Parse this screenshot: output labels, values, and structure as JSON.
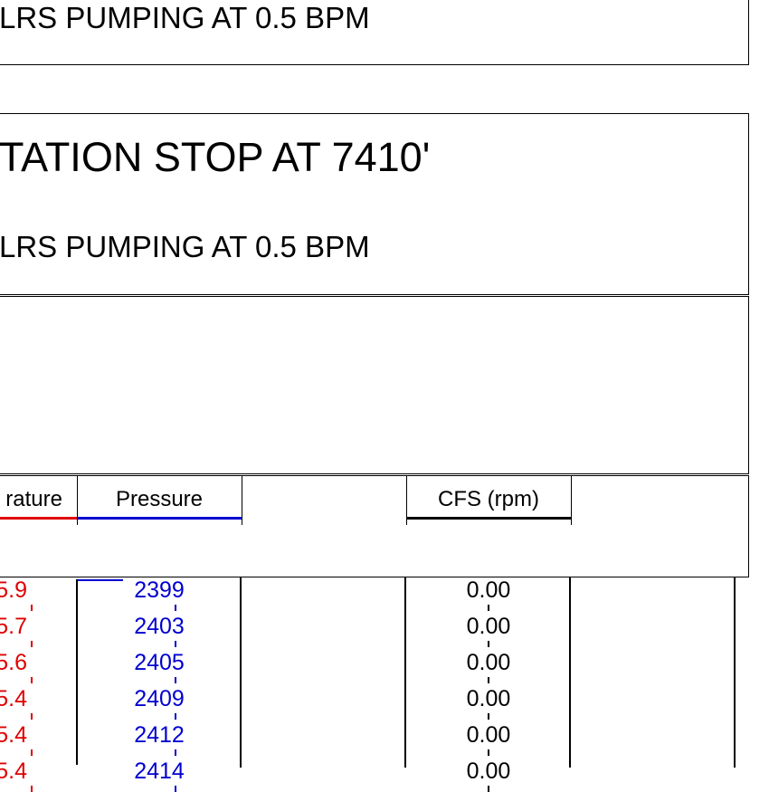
{
  "box1": {
    "text": "LRS PUMPING AT 0.5 BPM"
  },
  "box2": {
    "title": "TATION STOP AT 7410'",
    "text": "LRS PUMPING AT 0.5 BPM"
  },
  "headers": {
    "temperature": "rature",
    "pressure": "Pressure",
    "cfs": "CFS (rpm)"
  },
  "colors": {
    "temperature": "#e00000",
    "pressure": "#0000d0",
    "cfs": "#000000"
  },
  "rows": [
    {
      "temperature": "5.9",
      "pressure": "2399",
      "cfs": "0.00"
    },
    {
      "temperature": "5.7",
      "pressure": "2403",
      "cfs": "0.00"
    },
    {
      "temperature": "5.6",
      "pressure": "2405",
      "cfs": "0.00"
    },
    {
      "temperature": "5.4",
      "pressure": "2409",
      "cfs": "0.00"
    },
    {
      "temperature": "5.4",
      "pressure": "2412",
      "cfs": "0.00"
    },
    {
      "temperature": "5.4",
      "pressure": "2414",
      "cfs": "0.00"
    }
  ]
}
